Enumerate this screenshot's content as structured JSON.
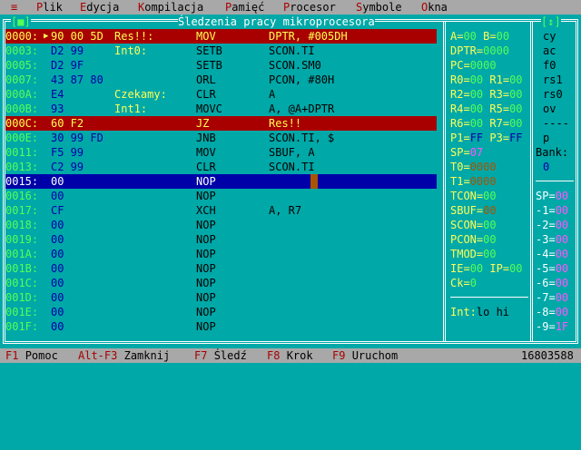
{
  "menu": {
    "sys": "≡",
    "items": [
      {
        "hot": "P",
        "rest": "lik"
      },
      {
        "hot": "E",
        "rest": "dycja"
      },
      {
        "hot": "K",
        "rest": "ompilacja"
      },
      {
        "hot": "P",
        "rest": "amięć"
      },
      {
        "hot": "P",
        "rest": "rocesor"
      },
      {
        "hot": "S",
        "rest": "ymbole"
      },
      {
        "hot": "O",
        "rest": "kna"
      }
    ]
  },
  "window": {
    "title": "Śledzenia pracy mikroprocesora",
    "close_button": "[■]",
    "zoom_button": "[↕]"
  },
  "code": [
    {
      "addr": "0000:",
      "hex": "90 00 5D",
      "label": "Res!!:",
      "mn": "MOV",
      "op": "DPTR, #005DH",
      "state": "bp",
      "arrow": "▶"
    },
    {
      "addr": "0003:",
      "hex": "D2 99",
      "label": "Int0:",
      "mn": "SETB",
      "op": "SCON.TI",
      "state": ""
    },
    {
      "addr": "0005:",
      "hex": "D2 9F",
      "label": "",
      "mn": "SETB",
      "op": "SCON.SM0",
      "state": ""
    },
    {
      "addr": "0007:",
      "hex": "43 87 80",
      "label": "",
      "mn": "ORL",
      "op": "PCON, #80H",
      "state": ""
    },
    {
      "addr": "000A:",
      "hex": "E4",
      "label": "Czekamy:",
      "mn": "CLR",
      "op": "A",
      "state": ""
    },
    {
      "addr": "000B:",
      "hex": "93",
      "label": "Int1:",
      "mn": "MOVC",
      "op": "A, @A+DPTR",
      "state": ""
    },
    {
      "addr": "000C:",
      "hex": "60 F2",
      "label": "",
      "mn": "JZ",
      "op": "Res!!",
      "state": "bp"
    },
    {
      "addr": "000E:",
      "hex": "30 99 FD",
      "label": "",
      "mn": "JNB",
      "op": "SCON.TI, $",
      "state": ""
    },
    {
      "addr": "0011:",
      "hex": "F5 99",
      "label": "",
      "mn": "MOV",
      "op": "SBUF, A",
      "state": ""
    },
    {
      "addr": "0013:",
      "hex": "C2 99",
      "label": "",
      "mn": "CLR",
      "op": "SCON.TI",
      "state": ""
    },
    {
      "addr": "0015:",
      "hex": "00",
      "label": "",
      "mn": "NOP",
      "op": "",
      "state": "cur"
    },
    {
      "addr": "0016:",
      "hex": "00",
      "label": "",
      "mn": "NOP",
      "op": "",
      "state": ""
    },
    {
      "addr": "0017:",
      "hex": "CF",
      "label": "",
      "mn": "XCH",
      "op": "A, R7",
      "state": ""
    },
    {
      "addr": "0018:",
      "hex": "00",
      "label": "",
      "mn": "NOP",
      "op": "",
      "state": ""
    },
    {
      "addr": "0019:",
      "hex": "00",
      "label": "",
      "mn": "NOP",
      "op": "",
      "state": ""
    },
    {
      "addr": "001A:",
      "hex": "00",
      "label": "",
      "mn": "NOP",
      "op": "",
      "state": ""
    },
    {
      "addr": "001B:",
      "hex": "00",
      "label": "",
      "mn": "NOP",
      "op": "",
      "state": ""
    },
    {
      "addr": "001C:",
      "hex": "00",
      "label": "",
      "mn": "NOP",
      "op": "",
      "state": ""
    },
    {
      "addr": "001D:",
      "hex": "00",
      "label": "",
      "mn": "NOP",
      "op": "",
      "state": ""
    },
    {
      "addr": "001E:",
      "hex": "00",
      "label": "",
      "mn": "NOP",
      "op": "",
      "state": ""
    },
    {
      "addr": "001F:",
      "hex": "00",
      "label": "",
      "mn": "NOP",
      "op": "",
      "state": ""
    }
  ],
  "registers": {
    "a_label": "A=",
    "a": "00",
    "b_label": "B=",
    "b": "00",
    "dptr_label": "DPTR=",
    "dptr": "0000",
    "pc_label": "PC=",
    "pc": "0000",
    "r0_label": "R0=",
    "r0": "00",
    "r1_label": "R1=",
    "r1": "00",
    "r2_label": "R2=",
    "r2": "00",
    "r3_label": "R3=",
    "r3": "00",
    "r4_label": "R4=",
    "r4": "00",
    "r5_label": "R5=",
    "r5": "00",
    "r6_label": "R6=",
    "r6": "00",
    "r7_label": "R7=",
    "r7": "00",
    "p1_label": "P1=",
    "p1": "FF",
    "p3_label": "P3=",
    "p3": "FF",
    "sp_label": "SP=",
    "sp": "07",
    "t0_label": "T0=",
    "t0": "0000",
    "t1_label": "T1=",
    "t1": "0000",
    "tcon_label": "TCON=",
    "tcon": "00",
    "sbuf_label": "SBUF=",
    "sbuf": "00",
    "scon_label": "SCON=",
    "scon": "00",
    "pcon_label": "PCON=",
    "pcon": "00",
    "tmod_label": "TMOD=",
    "tmod": "00",
    "ie_label": "IE=",
    "ie": "00",
    "ip_label": "IP=",
    "ip": "00",
    "ck_label": "Ck=",
    "ck": "0",
    "int_label": "Int:",
    "int_value": "lo hi"
  },
  "flags": [
    "cy",
    "ac",
    "f0",
    "rs1",
    "rs0",
    "ov",
    "----",
    "p"
  ],
  "bank_label": "Bank:",
  "bank": "0",
  "stack": [
    {
      "l": "SP=",
      "v": "00"
    },
    {
      "l": "-1=",
      "v": "00"
    },
    {
      "l": "-2=",
      "v": "00"
    },
    {
      "l": "-3=",
      "v": "00"
    },
    {
      "l": "-4=",
      "v": "00"
    },
    {
      "l": "-5=",
      "v": "00"
    },
    {
      "l": "-6=",
      "v": "00"
    },
    {
      "l": "-7=",
      "v": "00"
    },
    {
      "l": "-8=",
      "v": "00"
    },
    {
      "l": "-9=",
      "v": "1F"
    }
  ],
  "status": {
    "f1_key": "F1",
    "f1_label": "Pomoc",
    "altf3_key": "Alt-F3",
    "altf3_label": "Zamknij",
    "f7_key": "F7",
    "f7_label": "Śledź",
    "f8_key": "F8",
    "f8_label": "Krok",
    "f9_key": "F9",
    "f9_label": "Uruchom",
    "memory": "16803588"
  }
}
